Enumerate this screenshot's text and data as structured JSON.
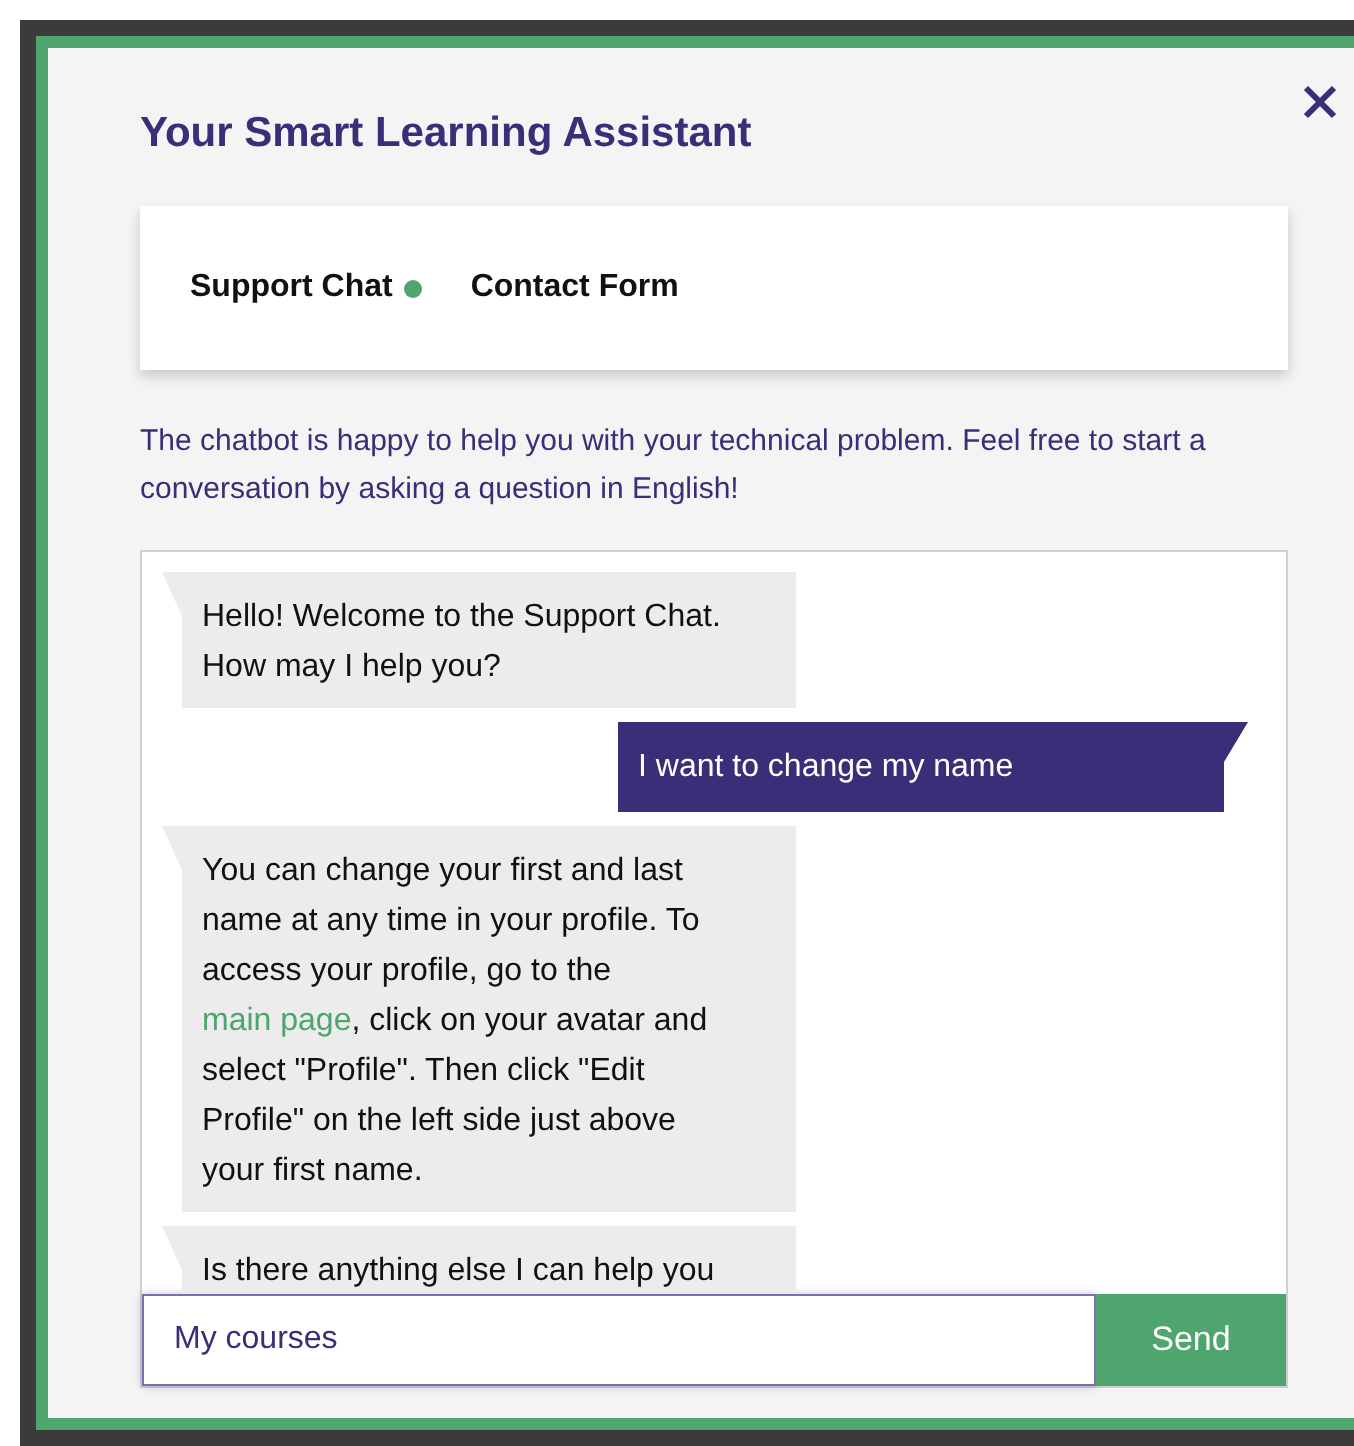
{
  "dialog": {
    "title": "Your Smart Learning Assistant"
  },
  "tabs": [
    {
      "label": "Support Chat",
      "selected": true
    },
    {
      "label": "Contact Form",
      "selected": false
    }
  ],
  "description": "The chatbot is happy to help you with your technical problem. Feel free to start a conversation by asking a question in English!",
  "messages": [
    {
      "kind": "bot",
      "parts": [
        {
          "kind": "text",
          "text": "Hello! Welcome to the Support Chat. How may I help you?"
        }
      ]
    },
    {
      "kind": "user",
      "parts": [
        {
          "kind": "text",
          "text": "I want to change my name"
        }
      ]
    },
    {
      "kind": "bot",
      "parts": [
        {
          "kind": "text",
          "text": "You can change your first and last name at any time in your profile. To access your profile, go to the "
        },
        {
          "kind": "link",
          "text": "main page"
        },
        {
          "kind": "text",
          "text": ", click on your avatar and select \"Profile\". Then click \"Edit Profile\" on the left side just above your first name."
        }
      ]
    },
    {
      "kind": "bot",
      "parts": [
        {
          "kind": "text",
          "text": "Is there anything else I can help you"
        }
      ]
    }
  ],
  "composer": {
    "value": "My courses",
    "send": "Send"
  }
}
